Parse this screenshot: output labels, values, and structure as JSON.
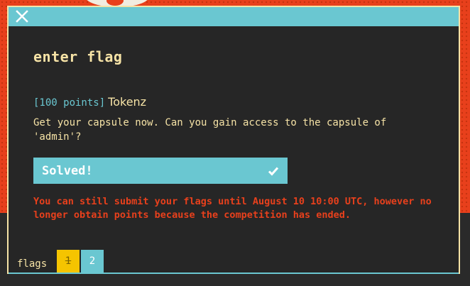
{
  "modal": {
    "title": "enter flag"
  },
  "challenge": {
    "points": "[100 points]",
    "name": "Tokenz",
    "description": "Get your capsule now. Can you gain access to the capsule of\n'admin'?"
  },
  "status": {
    "solved_label": "Solved!",
    "notice": "You can still submit your flags until August 10 10:00 UTC, however no longer obtain points because the competition has ended."
  },
  "tabs": {
    "label": "flags",
    "items": [
      {
        "label": "1",
        "state": "solved"
      },
      {
        "label": "2",
        "state": "open"
      }
    ]
  },
  "icons": {
    "close": "close-icon",
    "check": "check-icon"
  },
  "colors": {
    "accent": "#6ac7d1",
    "text": "#f6e3a6",
    "warning": "#e8401c",
    "tab_solved": "#f5c400"
  }
}
